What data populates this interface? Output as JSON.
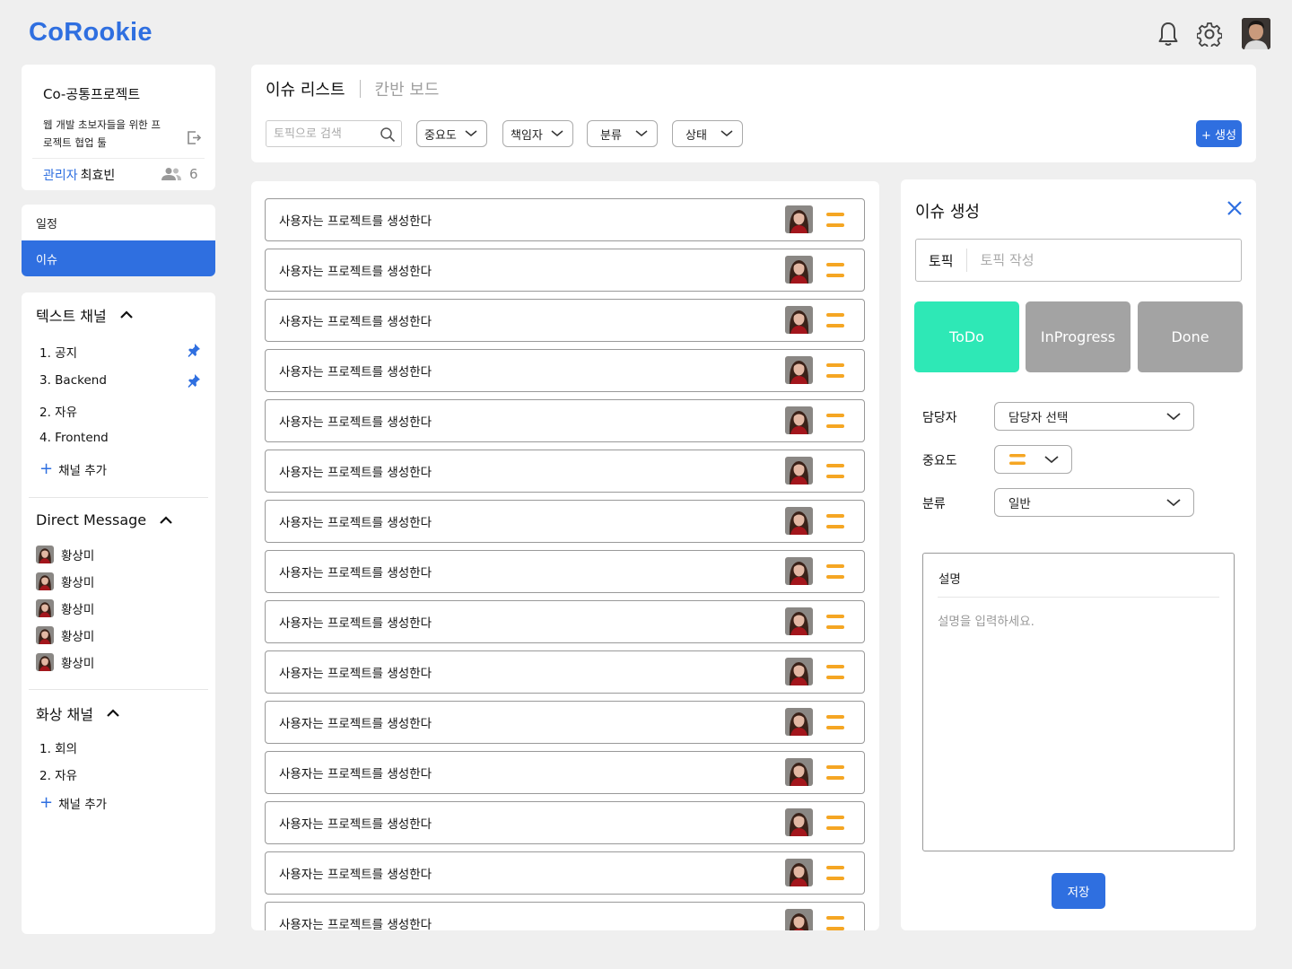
{
  "app": {
    "logo": "CoRookie"
  },
  "header": {
    "icons": [
      "bell-icon",
      "gear-icon",
      "user-avatar"
    ]
  },
  "project": {
    "title": "Co-공통프로젝트",
    "description": "웹 개발 초보자들을 위한 프로젝트 협업 툴",
    "admin_label": "관리자",
    "admin_name": "최효빈",
    "member_count": "6"
  },
  "nav": {
    "items": [
      {
        "label": "일정",
        "active": false
      },
      {
        "label": "이슈",
        "active": true
      }
    ]
  },
  "text_channels": {
    "title": "텍스트 채널",
    "items": [
      {
        "label": "1. 공지",
        "pinned": true
      },
      {
        "label": "3. Backend",
        "pinned": true
      },
      {
        "label": "2. 자유",
        "pinned": false
      },
      {
        "label": "4. Frontend",
        "pinned": false
      }
    ],
    "add_label": "채널 추가"
  },
  "direct_message": {
    "title": "Direct Message",
    "users": [
      "황상미",
      "황상미",
      "황상미",
      "황상미",
      "황상미"
    ]
  },
  "video_channels": {
    "title": "화상 채널",
    "items": [
      {
        "label": "1. 회의"
      },
      {
        "label": "2. 자유"
      }
    ],
    "add_label": "채널 추가"
  },
  "toolbar": {
    "tabs": [
      {
        "label": "이슈 리스트",
        "active": true
      },
      {
        "label": "칸반 보드",
        "active": false
      }
    ],
    "search_placeholder": "토픽으로 검색",
    "filters": [
      "중요도",
      "책임자",
      "분류",
      "상태"
    ],
    "create_label": "+ 생성"
  },
  "issues": [
    {
      "title": "사용자는 프로젝트를 생성한다",
      "priority": "medium"
    },
    {
      "title": "사용자는 프로젝트를 생성한다",
      "priority": "medium"
    },
    {
      "title": "사용자는 프로젝트를 생성한다",
      "priority": "medium"
    },
    {
      "title": "사용자는 프로젝트를 생성한다",
      "priority": "medium"
    },
    {
      "title": "사용자는 프로젝트를 생성한다",
      "priority": "medium"
    },
    {
      "title": "사용자는 프로젝트를 생성한다",
      "priority": "medium"
    },
    {
      "title": "사용자는 프로젝트를 생성한다",
      "priority": "medium"
    },
    {
      "title": "사용자는 프로젝트를 생성한다",
      "priority": "medium"
    },
    {
      "title": "사용자는 프로젝트를 생성한다",
      "priority": "medium"
    },
    {
      "title": "사용자는 프로젝트를 생성한다",
      "priority": "medium"
    },
    {
      "title": "사용자는 프로젝트를 생성한다",
      "priority": "medium"
    },
    {
      "title": "사용자는 프로젝트를 생성한다",
      "priority": "medium"
    },
    {
      "title": "사용자는 프로젝트를 생성한다",
      "priority": "medium"
    },
    {
      "title": "사용자는 프로젝트를 생성한다",
      "priority": "medium"
    },
    {
      "title": "사용자는 프로젝트를 생성한다",
      "priority": "medium"
    }
  ],
  "issue_form": {
    "title": "이슈 생성",
    "topic_label": "토픽",
    "topic_placeholder": "토픽 작성",
    "statuses": [
      {
        "label": "ToDo",
        "selected": true
      },
      {
        "label": "InProgress",
        "selected": false
      },
      {
        "label": "Done",
        "selected": false
      }
    ],
    "assignee_label": "담당자",
    "assignee_value": "담당자 선택",
    "priority_label": "중요도",
    "category_label": "분류",
    "category_value": "일반",
    "description_label": "설명",
    "description_placeholder": "설명을 입력하세요.",
    "save_label": "저장"
  },
  "colors": {
    "accent": "#2f6fe0",
    "todo": "#2ee8b6",
    "inactive_status": "#a3a3a3",
    "priority_medium": "#f5a623",
    "background": "#efefef"
  }
}
